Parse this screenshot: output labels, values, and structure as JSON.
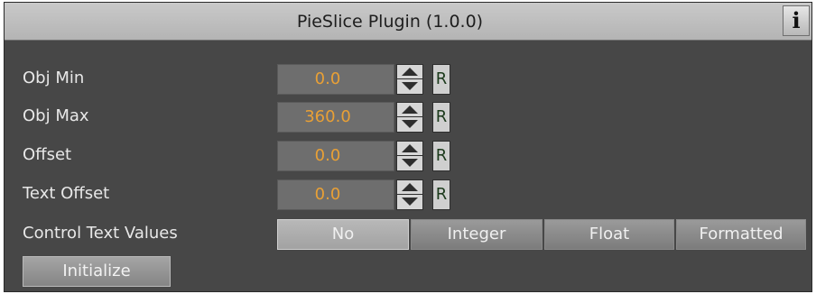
{
  "header": {
    "title": "PieSlice Plugin (1.0.0)",
    "info_label": "i"
  },
  "fields": [
    {
      "label": "Obj Min",
      "value": "0.0",
      "reset_label": "R"
    },
    {
      "label": "Obj Max",
      "value": "360.0",
      "reset_label": "R"
    },
    {
      "label": "Offset",
      "value": "0.0",
      "reset_label": "R"
    },
    {
      "label": "Text Offset",
      "value": "0.0",
      "reset_label": "R"
    }
  ],
  "control_text_values": {
    "label": "Control Text Values",
    "options": [
      "No",
      "Integer",
      "Float",
      "Formatted"
    ],
    "selected": "No"
  },
  "initialize_label": "Initialize",
  "colors": {
    "panel_bg": "#474747",
    "value_text": "#e9a035",
    "label_text": "#e8e8e8"
  }
}
